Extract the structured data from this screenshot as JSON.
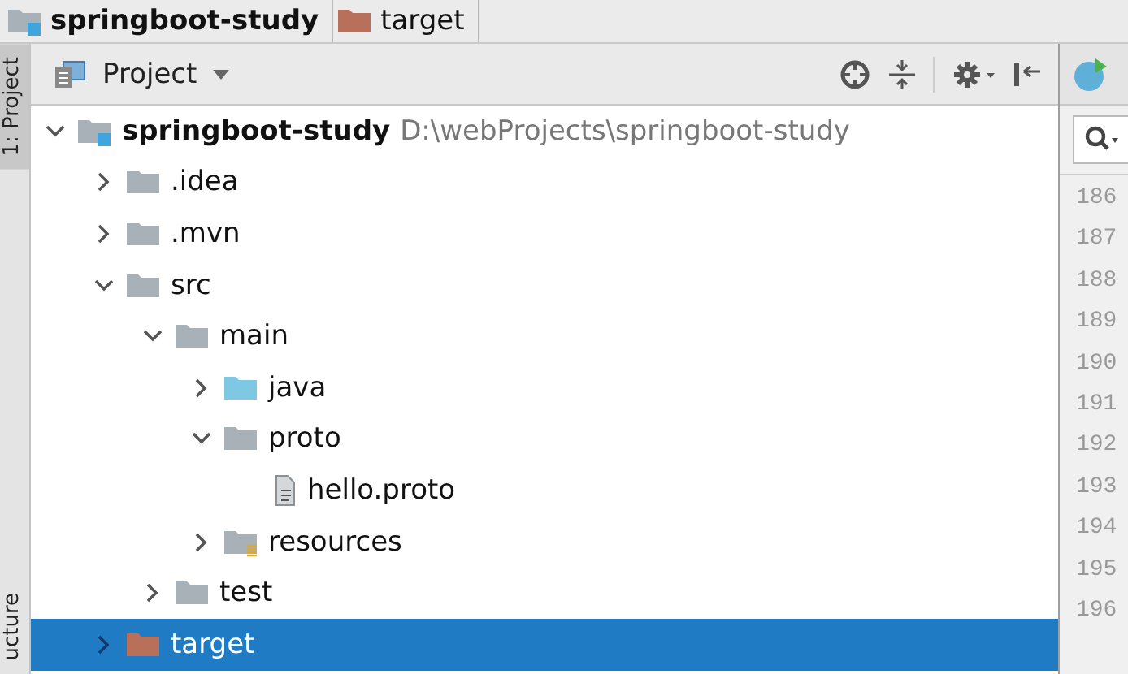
{
  "breadcrumbs": [
    {
      "label": "springboot-study",
      "kind": "module"
    },
    {
      "label": "target",
      "kind": "excluded"
    }
  ],
  "side_tabs": [
    {
      "label": "1: Project",
      "selected": true
    },
    {
      "label": "ucture",
      "selected": false
    }
  ],
  "panel": {
    "title": "Project"
  },
  "tree": [
    {
      "label": "springboot-study",
      "path": "D:\\webProjects\\springboot-study",
      "kind": "module",
      "expanded": true,
      "selected": false,
      "children": [
        {
          "label": ".idea",
          "kind": "folder",
          "expanded": false,
          "selected": false
        },
        {
          "label": ".mvn",
          "kind": "folder",
          "expanded": false,
          "selected": false
        },
        {
          "label": "src",
          "kind": "folder",
          "expanded": true,
          "selected": false,
          "children": [
            {
              "label": "main",
              "kind": "folder",
              "expanded": true,
              "selected": false,
              "children": [
                {
                  "label": "java",
                  "kind": "source",
                  "expanded": false,
                  "selected": false
                },
                {
                  "label": "proto",
                  "kind": "folder",
                  "expanded": true,
                  "selected": false,
                  "children": [
                    {
                      "label": "hello.proto",
                      "kind": "file",
                      "selected": false
                    }
                  ]
                },
                {
                  "label": "resources",
                  "kind": "resources",
                  "expanded": false,
                  "selected": false
                }
              ]
            },
            {
              "label": "test",
              "kind": "folder",
              "expanded": false,
              "selected": false
            }
          ]
        },
        {
          "label": "target",
          "kind": "excluded",
          "expanded": false,
          "selected": true
        }
      ]
    }
  ],
  "editor": {
    "line_numbers": [
      "186",
      "187",
      "188",
      "189",
      "190",
      "191",
      "192",
      "193",
      "194",
      "195",
      "196"
    ]
  }
}
